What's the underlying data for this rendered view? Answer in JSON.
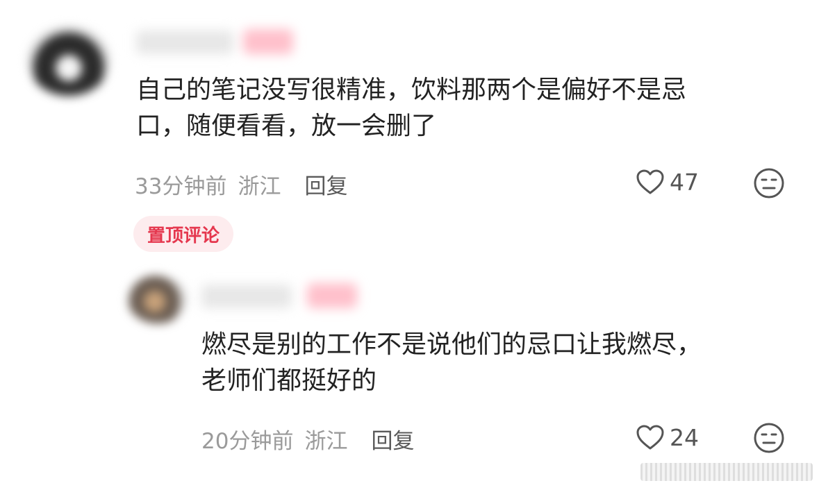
{
  "comments": [
    {
      "text_lines": [
        "自己的笔记没写很精准，饮料那两个是偏好不是忌",
        "口，随便看看，放一会删了"
      ],
      "time": "33分钟前",
      "location": "浙江",
      "reply_label": "回复",
      "likes": "47",
      "badge": "置顶评论"
    },
    {
      "text_lines": [
        "燃尽是别的工作不是说他们的忌口让我燃尽，",
        "老师们都挺好的"
      ],
      "time": "20分钟前",
      "location": "浙江",
      "reply_label": "回复",
      "likes": "24"
    }
  ],
  "colors": {
    "text": "#222222",
    "meta": "#9a9a9a",
    "badge_bg": "#fdecee",
    "badge_text": "#e5374e"
  },
  "icons": [
    "heart-outline-icon",
    "expressionless-face-icon"
  ]
}
